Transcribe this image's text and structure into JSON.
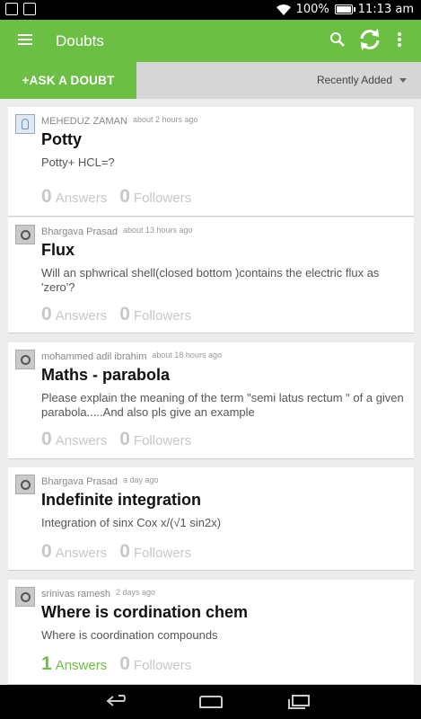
{
  "status_bar": {
    "battery_percent": "100%",
    "time": "11:13",
    "ampm": "am"
  },
  "app_bar": {
    "title": "Doubts",
    "icons": [
      "menu-icon",
      "search-icon",
      "refresh-icon",
      "more-vert-icon"
    ]
  },
  "action_row": {
    "ask_button": "+ASK A DOUBT",
    "sort_label": "Recently Added"
  },
  "labels": {
    "answers": "Answers",
    "followers": "Followers"
  },
  "colors": {
    "accent": "#6cbe44",
    "muted_count": "#c8c8c8"
  },
  "doubts": [
    {
      "author": "MEHEDUZ ZAMAN",
      "time": "about 2 hours ago",
      "title": "Potty",
      "body": "Potty+ HCL=?",
      "answers": "0",
      "followers": "0"
    },
    {
      "author": "Bhargava Prasad",
      "time": "about 13 hours ago",
      "title": "Flux",
      "body": "Will an sphwrical shell(closed bottom )contains the electric flux as 'zero'?",
      "answers": "0",
      "followers": "0"
    },
    {
      "author": "mohammed adil ibrahim",
      "time": "about 18 hours ago",
      "title": "Maths - parabola",
      "body": "Please explain the meaning of the term \"semi latus rectum \" of a given parabola.....And also pls give an example",
      "answers": "0",
      "followers": "0"
    },
    {
      "author": "Bhargava Prasad",
      "time": "a day ago",
      "title": "Indefinite integration",
      "body": "Integration of sinx Cox x/(√1 sin2x)",
      "answers": "0",
      "followers": "0"
    },
    {
      "author": "srinivas ramesh",
      "time": "2 days ago",
      "title": "Where is cordination chem",
      "body": "Where is coordination compounds",
      "answers": "1",
      "followers": "0"
    }
  ]
}
